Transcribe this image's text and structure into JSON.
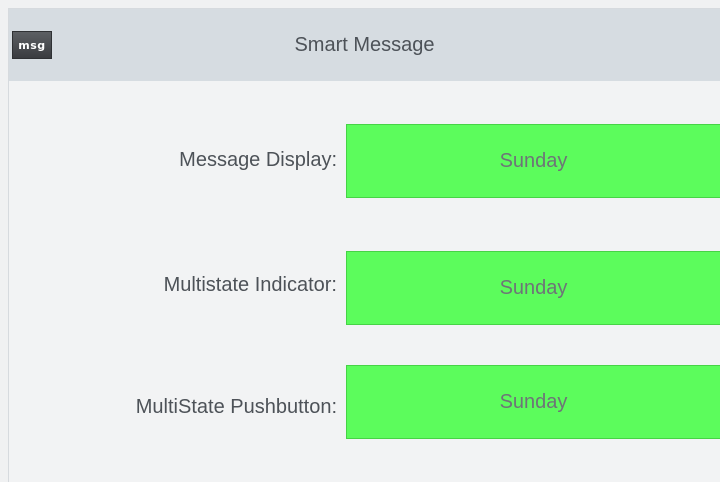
{
  "window": {
    "title": "Smart Message",
    "icon_text": "msg"
  },
  "rows": [
    {
      "label": "Message Display:",
      "value": "Sunday"
    },
    {
      "label": "Multistate Indicator:",
      "value": "Sunday"
    },
    {
      "label": "MultiState Pushbutton:",
      "value": "Sunday"
    }
  ],
  "colors": {
    "titlebar": "#d6dce1",
    "background": "#f2f3f4",
    "field_green": "#5cfc5c",
    "text": "#4d5258"
  }
}
